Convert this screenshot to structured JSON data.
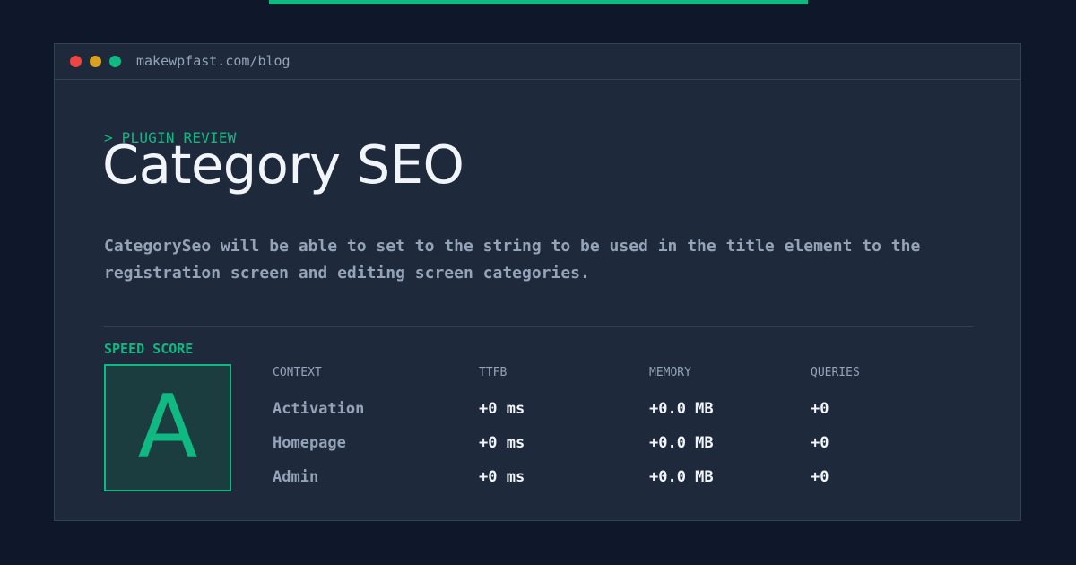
{
  "colors": {
    "page_background": "#0f172a",
    "window_background": "#1e293b",
    "accent": "#10b981",
    "muted_text": "#94a3b8",
    "primary_text": "#f1f5f9",
    "window_control_red": "#ef4444",
    "window_control_yellow": "#d9a021",
    "window_control_green": "#10b981"
  },
  "window": {
    "controls": [
      "close-dot",
      "minimize-dot",
      "maximize-dot"
    ],
    "url": "makewpfast.com/blog"
  },
  "hero": {
    "eyebrow": "> PLUGIN REVIEW",
    "title": "Category SEO",
    "description": "CategorySeo will be able to set to the string to be used in the title element to the registration screen and editing screen categories."
  },
  "speed": {
    "label": "SPEED SCORE",
    "grade": "A",
    "columns": [
      "CONTEXT",
      "TTFB",
      "MEMORY",
      "QUERIES"
    ],
    "rows": [
      {
        "context": "Activation",
        "ttfb": "+0 ms",
        "memory": "+0.0 MB",
        "queries": "+0"
      },
      {
        "context": "Homepage",
        "ttfb": "+0 ms",
        "memory": "+0.0 MB",
        "queries": "+0"
      },
      {
        "context": "Admin",
        "ttfb": "+0 ms",
        "memory": "+0.0 MB",
        "queries": "+0"
      }
    ]
  }
}
